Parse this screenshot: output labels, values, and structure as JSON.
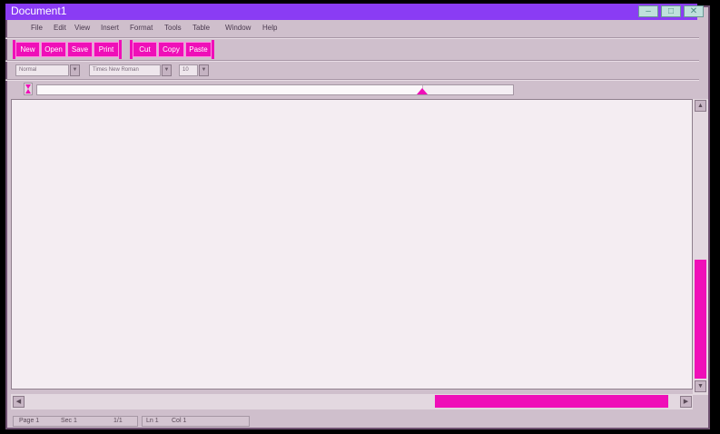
{
  "app": {
    "title": "Document1"
  },
  "window_controls": {
    "minimize": "–",
    "maximize": "□",
    "close": "✕"
  },
  "menu": [
    "File",
    "Edit",
    "View",
    "Insert",
    "Format",
    "Tools",
    "Table",
    "Window",
    "Help"
  ],
  "toolbar": {
    "file_buttons": [
      "New",
      "Open",
      "Save",
      "Print"
    ],
    "edit_buttons": [
      "Cut",
      "Copy",
      "Paste"
    ]
  },
  "format_bar": {
    "style": "Normal",
    "font": "Times New Roman",
    "size": "10"
  },
  "statusbar": {
    "page": "Page 1",
    "sec": "Sec 1",
    "pages": "1/1",
    "line": "Ln 1",
    "col": "Col 1"
  },
  "colors": {
    "accent": "#ef0fb8",
    "titlebar": "#8a3cf4",
    "window_bg": "#cfbfcc",
    "page_bg": "#f4edf2"
  },
  "icons": {
    "up": "scroll-up-arrow-icon",
    "down": "scroll-down-arrow-icon",
    "left": "scroll-left-arrow-icon",
    "right": "scroll-right-arrow-icon",
    "dropdown": "dropdown-arrow-icon"
  }
}
